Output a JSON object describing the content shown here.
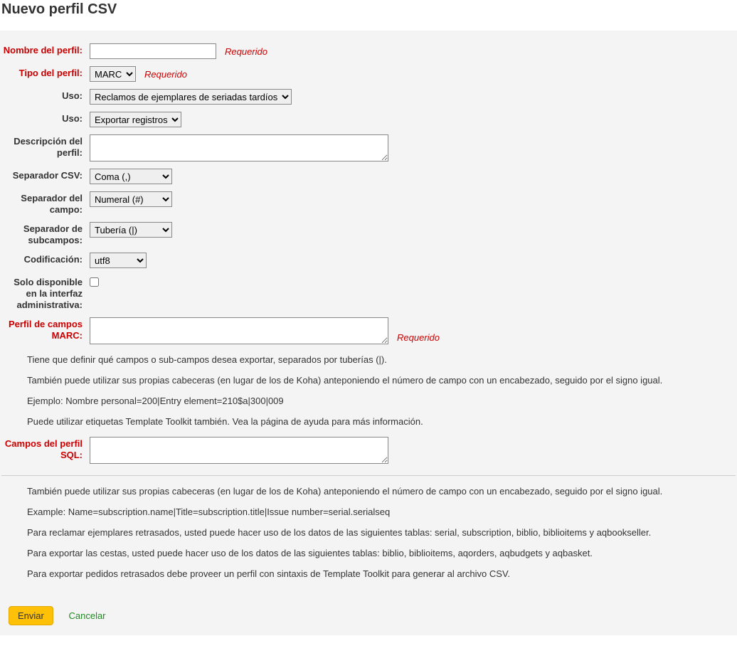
{
  "header": {
    "title": "Nuevo perfil CSV"
  },
  "labels": {
    "profile_name": "Nombre del perfil:",
    "profile_type": "Tipo del perfil:",
    "usage1": "Uso:",
    "usage2": "Uso:",
    "description": "Descripción del perfil:",
    "csv_separator": "Separador CSV:",
    "field_separator": "Separador del campo:",
    "subfield_separator": "Separador de subcampos:",
    "encoding": "Codificación:",
    "staff_only": "Solo disponible en la interfaz administrativa:",
    "marc_fields": "Perfil de campos MARC:",
    "sql_fields": "Campos del perfil SQL:"
  },
  "hints": {
    "required": "Requerido"
  },
  "values": {
    "profile_name": "",
    "profile_type": "MARC",
    "usage1": "Reclamos de ejemplares de seriadas tardíos",
    "usage2": "Exportar registros",
    "description": "",
    "csv_separator": "Coma (,)",
    "field_separator": "Numeral (#)",
    "subfield_separator": "Tubería (|)",
    "encoding": "utf8",
    "marc_fields": "",
    "sql_fields": ""
  },
  "help_marc": {
    "p1": "Tiene que definir qué campos o sub-campos desea exportar, separados por tuberías (|).",
    "p2": "También puede utilizar sus propias cabeceras (en lugar de los de Koha) anteponiendo el número de campo con un encabezado, seguido por el signo igual.",
    "p3": "Ejemplo: Nombre personal=200|Entry element=210$a|300|009",
    "p4": "Puede utilizar etiquetas Template Toolkit también. Vea la página de ayuda para más información."
  },
  "help_sql": {
    "p1": "También puede utilizar sus propias cabeceras (en lugar de los de Koha) anteponiendo el número de campo con un encabezado, seguido por el signo igual.",
    "p2": "Example: Name=subscription.name|Title=subscription.title|Issue number=serial.serialseq",
    "p3": "Para reclamar ejemplares retrasados, usted puede hacer uso de los datos de las siguientes tablas: serial, subscription, biblio, biblioitems y aqbookseller.",
    "p4": "Para exportar las cestas, usted puede hacer uso de los datos de las siguientes tablas: biblio, biblioitems, aqorders, aqbudgets y aqbasket.",
    "p5": "Para exportar pedidos retrasados debe proveer un perfil con sintaxis de Template Toolkit para generar al archivo CSV."
  },
  "actions": {
    "submit": "Enviar",
    "cancel": "Cancelar"
  }
}
